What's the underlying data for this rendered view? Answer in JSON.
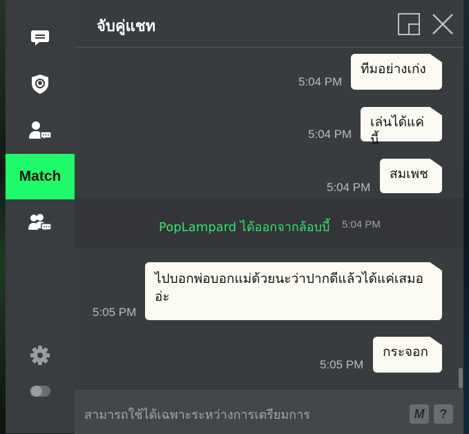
{
  "sidebar": {
    "items": [
      {
        "icon": "chat-bubble-icon"
      },
      {
        "icon": "team-shield-icon"
      },
      {
        "icon": "user-chat-icon"
      },
      {
        "label": "Match"
      },
      {
        "icon": "group-chat-icon"
      }
    ],
    "bottom_icons": [
      "gear-icon",
      "toggle-icon"
    ]
  },
  "header": {
    "title": "จับคู่แชท",
    "buttons": [
      "popout-icon",
      "close-icon"
    ]
  },
  "messages": [
    {
      "text": "ทีมอย่างเก่ง",
      "time": "5:04 PM"
    },
    {
      "text": "เล่นได้แค่นี้",
      "time": "5:04 PM"
    },
    {
      "text": "สมเพช",
      "time": "5:04 PM"
    },
    {
      "text": "ไปบอกพ่อบอกแม่ด้วยนะว่าปากดีแล้วได้แค่เสมอ อ่ะ",
      "time": "5:05 PM"
    },
    {
      "text": "กระจอก",
      "time": "5:05 PM"
    }
  ],
  "system_message": {
    "text": "PopLampard ได้ออกจากล้อบบี้",
    "time": "5:04 PM",
    "color": "#2fe86d"
  },
  "footer": {
    "notice": "สามารถใช้ได้เฉพาะระหว่างการเตรียมการ",
    "buttons": [
      {
        "label": "M"
      },
      {
        "label": "?"
      }
    ]
  },
  "colors": {
    "accent": "#1dfa6a",
    "bubble": "#fbfbf4"
  }
}
